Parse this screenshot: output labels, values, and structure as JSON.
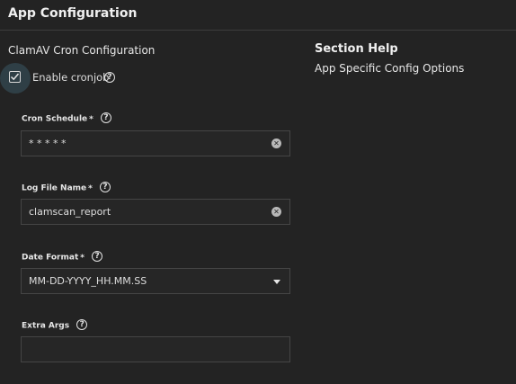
{
  "header": {
    "title": "App Configuration"
  },
  "section": {
    "title": "ClamAV Cron Configuration",
    "enable_cronjob": {
      "label": "Enable cronjob",
      "checked": true
    }
  },
  "fields": {
    "cron_schedule": {
      "label": "Cron Schedule",
      "required": "*",
      "value": "* * * * *"
    },
    "log_file_name": {
      "label": "Log File Name",
      "required": "*",
      "value": "clamscan_report"
    },
    "date_format": {
      "label": "Date Format",
      "required": "*",
      "value": "MM-DD-YYYY_HH.MM.SS"
    },
    "extra_args": {
      "label": "Extra Args",
      "value": ""
    }
  },
  "help_panel": {
    "title": "Section Help",
    "text": "App Specific Config Options"
  },
  "icons": {
    "help": "help-circle-icon",
    "clear": "clear-circle-icon",
    "dropdown": "caret-down-icon",
    "check": "checkmark-icon"
  },
  "colors": {
    "background": "#232323",
    "checkbox_highlight": "#2f3f46",
    "input_border": "#454545"
  }
}
